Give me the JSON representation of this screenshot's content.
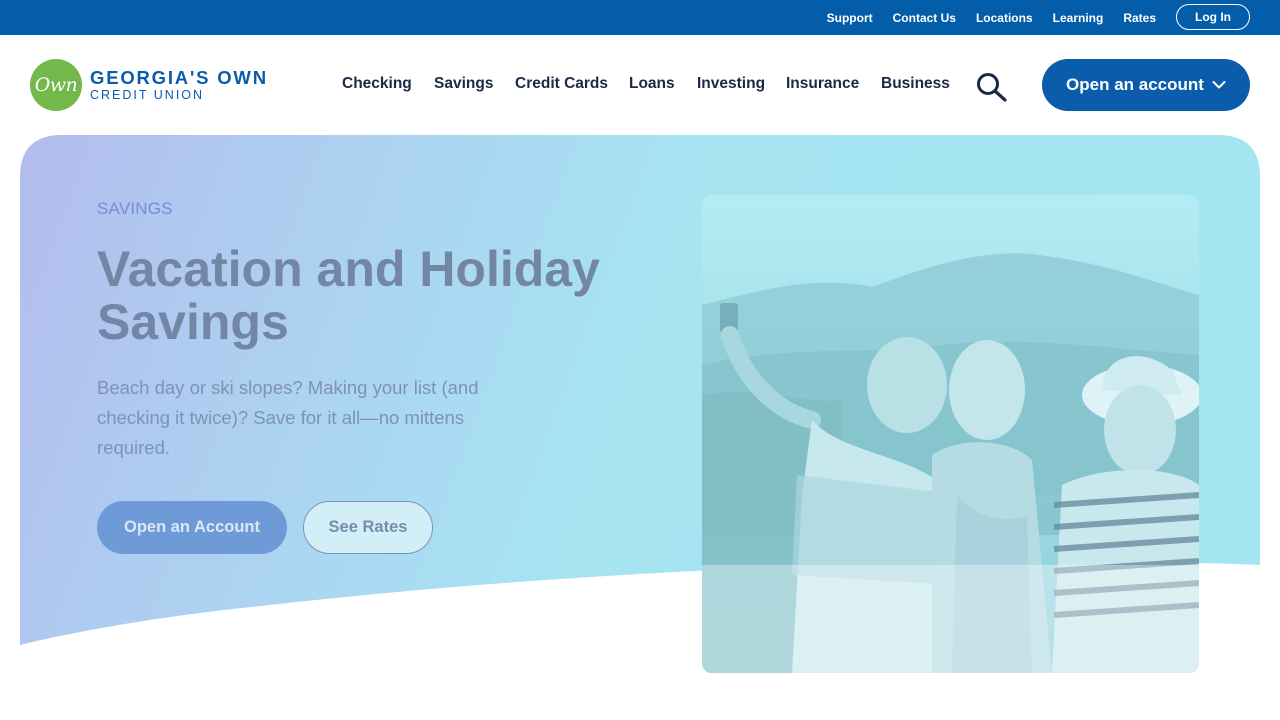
{
  "utility_nav": {
    "links": [
      "Support",
      "Contact Us",
      "Locations",
      "Learning",
      "Rates"
    ],
    "login_label": "Log In"
  },
  "brand": {
    "badge_text": "Own",
    "name_line1": "GEORGIA'S OWN",
    "name_line2": "CREDIT UNION",
    "colors": {
      "primary": "#0b5cab",
      "badge": "#72b84a",
      "utility_bar": "#045da9"
    }
  },
  "main_nav": {
    "items": [
      "Checking",
      "Savings",
      "Credit Cards",
      "Loans",
      "Investing",
      "Insurance",
      "Business"
    ],
    "search_icon": "search-icon",
    "cta_label": "Open an account",
    "cta_icon": "chevron-down-icon"
  },
  "hero": {
    "eyebrow": "SAVINGS",
    "title": "Vacation and Holiday Savings",
    "description": "Beach day or ski slopes? Making your list (and checking it twice)? Save for it all—no mittens required.",
    "primary_button": "Open an Account",
    "secondary_button": "See Rates",
    "image_subject": "three women taking a selfie on a mountain overlook"
  }
}
